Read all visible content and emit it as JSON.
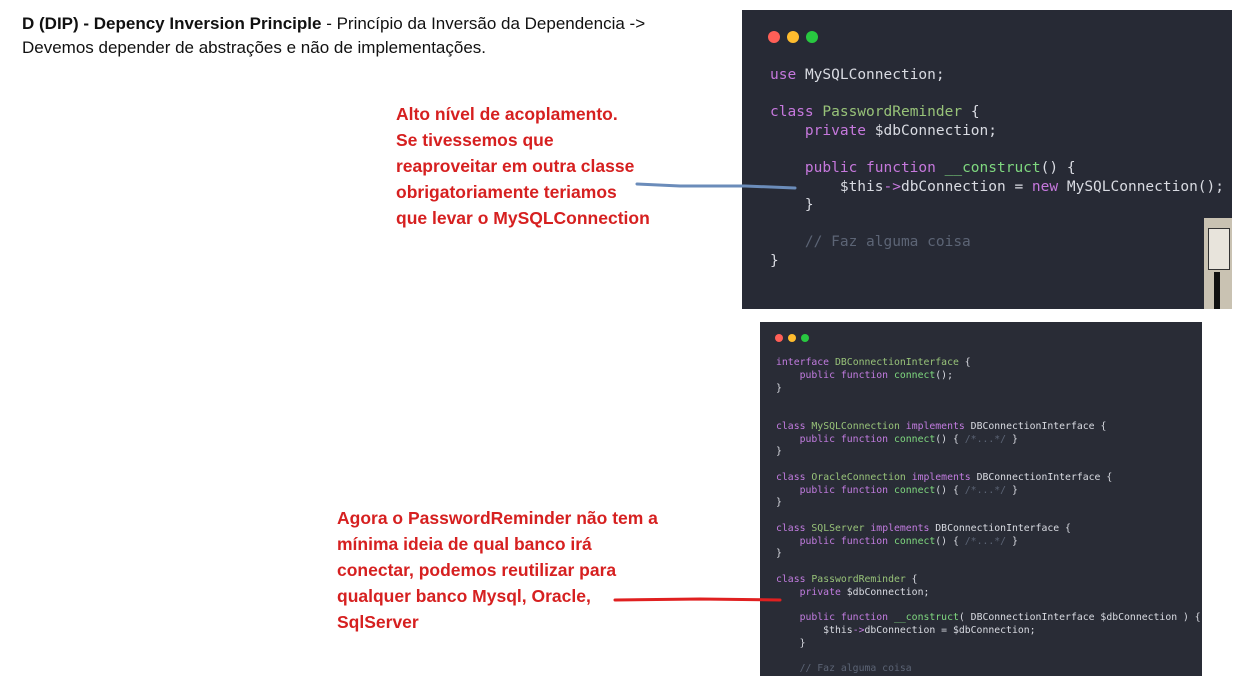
{
  "header": {
    "bold_title": "D (DIP) - Depency Inversion Principle",
    "description_line1": " - Princípio da Inversão da Dependencia ->",
    "description_line2": "Devemos depender de abstrações e não de implementações."
  },
  "note_top": {
    "lines": [
      "Alto nível de acoplamento.",
      "Se tivessemos que",
      "reaproveitar em outra classe",
      "obrigatoriamente teriamos",
      "que levar o MySQLConnection"
    ]
  },
  "note_bottom": {
    "lines": [
      "Agora o PasswordReminder não tem a",
      "mínima ideia de qual banco irá",
      "conectar, podemos reutilizar para",
      "qualquer banco Mysql, Oracle,",
      "SqlServer"
    ]
  },
  "code_top": {
    "lines": [
      "use MySQLConnection;",
      "",
      "class PasswordReminder {",
      "    private $dbConnection;",
      "",
      "    public function __construct() {",
      "        $this->dbConnection = new MySQLConnection();",
      "    }",
      "",
      "    // Faz alguma coisa",
      "}"
    ]
  },
  "code_bottom": {
    "lines": [
      "interface DBConnectionInterface {",
      "    public function connect();",
      "}",
      "",
      "",
      "class MySQLConnection implements DBConnectionInterface {",
      "    public function connect() { /*...*/ }",
      "}",
      "",
      "class OracleConnection implements DBConnectionInterface {",
      "    public function connect() { /*...*/ }",
      "}",
      "",
      "class SQLServer implements DBConnectionInterface {",
      "    public function connect() { /*...*/ }",
      "}",
      "",
      "class PasswordReminder {",
      "    private $dbConnection;",
      "",
      "    public function __construct( DBConnectionInterface $dbConnection ) {",
      "        $this->dbConnection = $dbConnection;",
      "    }",
      "",
      "    // Faz alguma coisa"
    ]
  },
  "colors": {
    "annotation_red": "#d62020",
    "connector_top": "#6b8cba",
    "connector_bottom": "#e02020",
    "code_bg": "#272a35"
  }
}
